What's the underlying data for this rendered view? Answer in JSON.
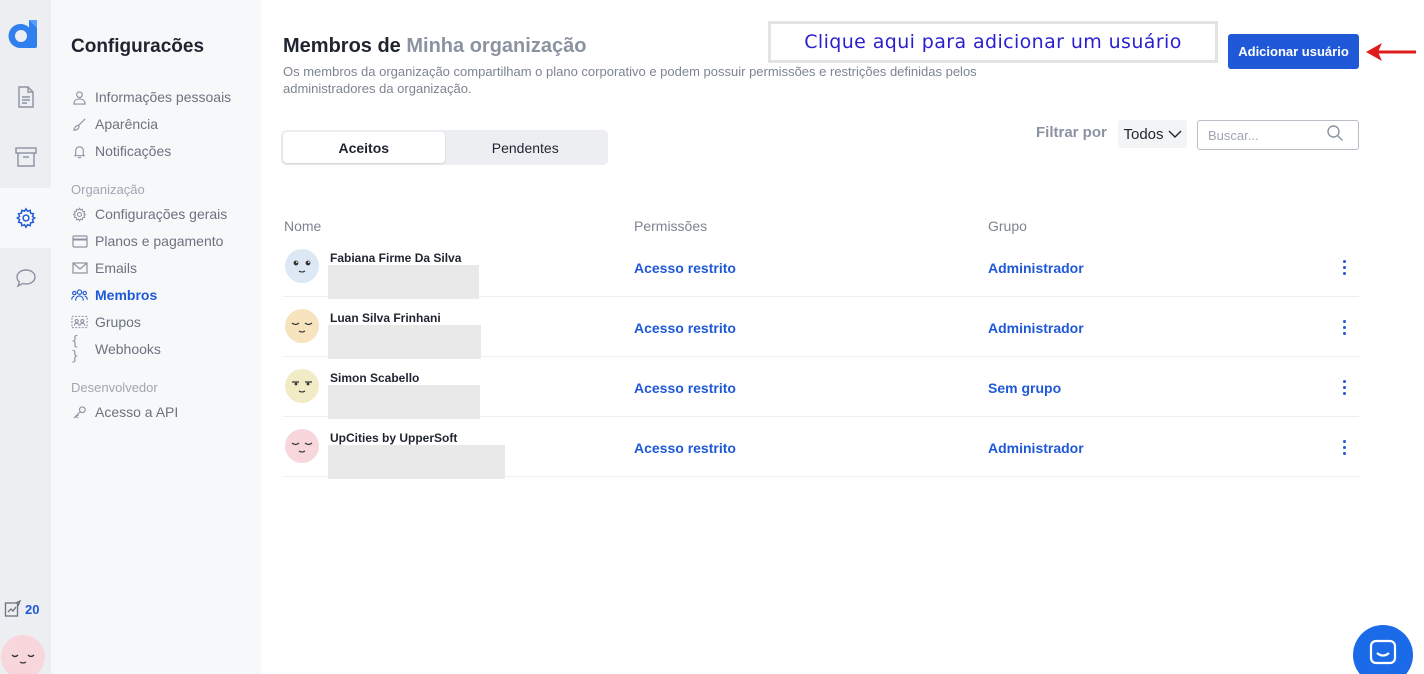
{
  "rail": {
    "credits": "20",
    "brand_color": "#1f59d8",
    "icons": [
      "logo-icon",
      "document-icon",
      "archive-icon",
      "gear-icon",
      "chat-icon",
      "chart-icon"
    ]
  },
  "sidebar": {
    "title": "Configuracões",
    "personal": [
      {
        "label": "Informações pessoais",
        "icon": "user-icon"
      },
      {
        "label": "Aparência",
        "icon": "brush-icon"
      },
      {
        "label": "Notificações",
        "icon": "bell-icon"
      }
    ],
    "org_section": "Organização",
    "org": [
      {
        "label": "Configurações gerais",
        "icon": "gear-icon"
      },
      {
        "label": "Planos e pagamento",
        "icon": "card-icon"
      },
      {
        "label": "Emails",
        "icon": "mail-icon"
      },
      {
        "label": "Membros",
        "icon": "users-icon",
        "active": true
      },
      {
        "label": "Grupos",
        "icon": "groups-icon"
      },
      {
        "label": "Webhooks",
        "icon": "braces-icon"
      }
    ],
    "dev_section": "Desenvolvedor",
    "dev": [
      {
        "label": "Acesso a API",
        "icon": "key-icon"
      }
    ]
  },
  "header": {
    "title_prefix": "Membros de",
    "org_name": "Minha organização",
    "description": "Os membros da organização compartilham o plano corporativo e podem possuir permissões e restrições definidas pelos administradores da organização.",
    "callout": "Clique aqui para adicionar um usuário",
    "add_button": "Adicionar usuário"
  },
  "tabs": [
    {
      "label": "Aceitos",
      "active": true
    },
    {
      "label": "Pendentes",
      "active": false
    }
  ],
  "filter": {
    "label": "Filtrar por",
    "selected": "Todos",
    "search_placeholder": "Buscar..."
  },
  "table": {
    "headers": [
      "Nome",
      "Permissões",
      "Grupo"
    ],
    "rows": [
      {
        "name": "Fabiana Firme Da Silva",
        "permission": "Acesso restrito",
        "group": "Administrador",
        "avatar_color": "#dce8f4"
      },
      {
        "name": "Luan Silva Frinhani",
        "permission": "Acesso restrito",
        "group": "Administrador",
        "avatar_color": "#f7e3bd"
      },
      {
        "name": "Simon Scabello",
        "permission": "Acesso restrito",
        "group": "Sem grupo",
        "avatar_color": "#f1ecc6"
      },
      {
        "name": "UpCities by UpperSoft",
        "permission": "Acesso restrito",
        "group": "Administrador",
        "avatar_color": "#f8d7dc"
      }
    ]
  }
}
